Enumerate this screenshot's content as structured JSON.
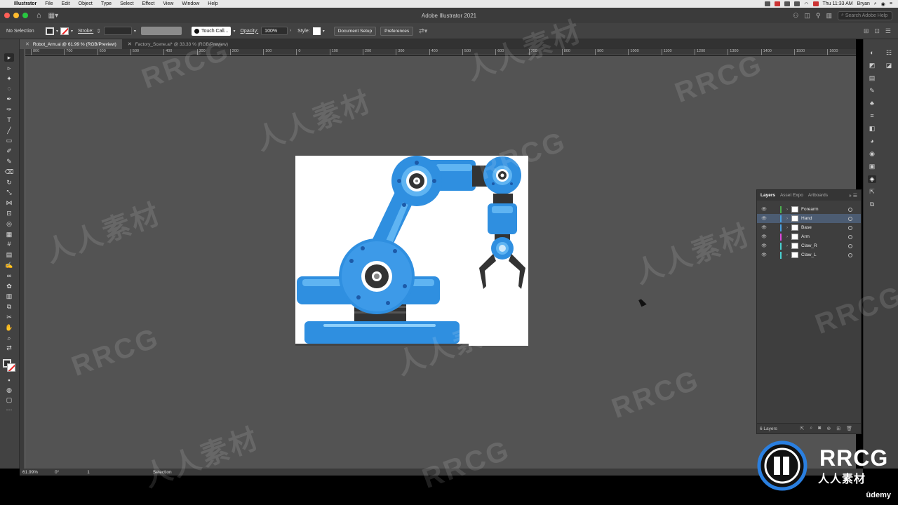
{
  "menubar": {
    "items": [
      "Illustrator",
      "File",
      "Edit",
      "Object",
      "Type",
      "Select",
      "Effect",
      "View",
      "Window",
      "Help"
    ],
    "clock": "Thu 11:33 AM",
    "user": "Bryan"
  },
  "titlebar": {
    "title": "Adobe Illustrator 2021",
    "search_placeholder": "Search Adobe Help"
  },
  "controlbar": {
    "selection": "No Selection",
    "stroke_label": "Stroke:",
    "brush": "Touch Call...",
    "opacity_label": "Opacity:",
    "opacity_value": "100%",
    "style_label": "Style:",
    "document_setup": "Document Setup",
    "preferences": "Preferences"
  },
  "tabs": [
    {
      "label": "Robot_Arm.ai @ 61.99 % (RGB/Preview)",
      "active": true
    },
    {
      "label": "Factory_Scene.ai* @ 33.33 % (RGB/Preview)",
      "active": false
    }
  ],
  "ruler": {
    "ticks": [
      "800",
      "700",
      "600",
      "500",
      "400",
      "300",
      "200",
      "100",
      "0",
      "100",
      "200",
      "300",
      "400",
      "500",
      "600",
      "700",
      "800",
      "900",
      "1000",
      "1100",
      "1200",
      "1300",
      "1400",
      "1500",
      "1600"
    ]
  },
  "layers_panel": {
    "tabs": [
      "Layers",
      "Asset Expo",
      "Artboards"
    ],
    "layers": [
      {
        "name": "Forearm",
        "color": "#4caf50",
        "selected": false
      },
      {
        "name": "Hand",
        "color": "#4aa0e0",
        "selected": true
      },
      {
        "name": "Base",
        "color": "#4aa0e0",
        "selected": false
      },
      {
        "name": "Arm",
        "color": "#e04adf",
        "selected": false
      },
      {
        "name": "Claw_R",
        "color": "#4ad0d0",
        "selected": false
      },
      {
        "name": "Claw_L",
        "color": "#4ad0d0",
        "selected": false
      }
    ],
    "footer": "6 Layers"
  },
  "statusbar": {
    "zoom": "61.99%",
    "angle": "0°",
    "page": "1",
    "tool": "Selection"
  },
  "branding": {
    "udemy": "ûdemy",
    "watermark": "RRCG",
    "watermark_cn": "人人素材"
  },
  "colors": {
    "robot_blue": "#2f8fe0",
    "robot_light": "#5fb4f2",
    "robot_dark": "#333333",
    "canvas": "#535353"
  }
}
